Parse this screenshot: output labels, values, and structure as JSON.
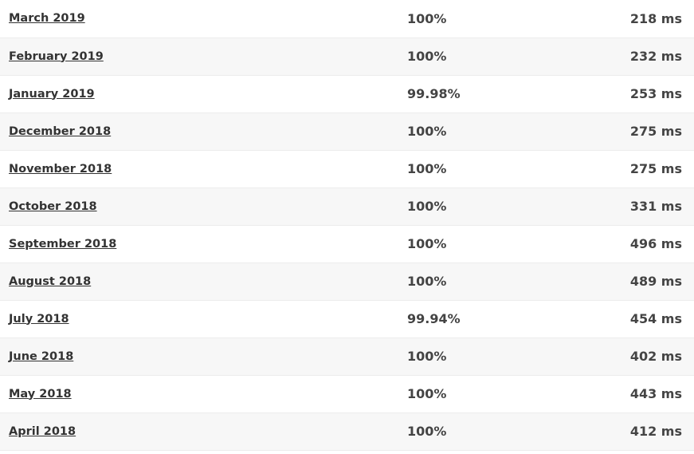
{
  "rows": [
    {
      "month": "March 2019",
      "uptime": "100%",
      "response": "218 ms"
    },
    {
      "month": "February 2019",
      "uptime": "100%",
      "response": "232 ms"
    },
    {
      "month": "January 2019",
      "uptime": "99.98%",
      "response": "253 ms"
    },
    {
      "month": "December 2018",
      "uptime": "100%",
      "response": "275 ms"
    },
    {
      "month": "November 2018",
      "uptime": "100%",
      "response": "275 ms"
    },
    {
      "month": "October 2018",
      "uptime": "100%",
      "response": "331 ms"
    },
    {
      "month": "September 2018",
      "uptime": "100%",
      "response": "496 ms"
    },
    {
      "month": "August 2018",
      "uptime": "100%",
      "response": "489 ms"
    },
    {
      "month": "July 2018",
      "uptime": "99.94%",
      "response": "454 ms"
    },
    {
      "month": "June 2018",
      "uptime": "100%",
      "response": "402 ms"
    },
    {
      "month": "May 2018",
      "uptime": "100%",
      "response": "443 ms"
    },
    {
      "month": "April 2018",
      "uptime": "100%",
      "response": "412 ms"
    }
  ]
}
